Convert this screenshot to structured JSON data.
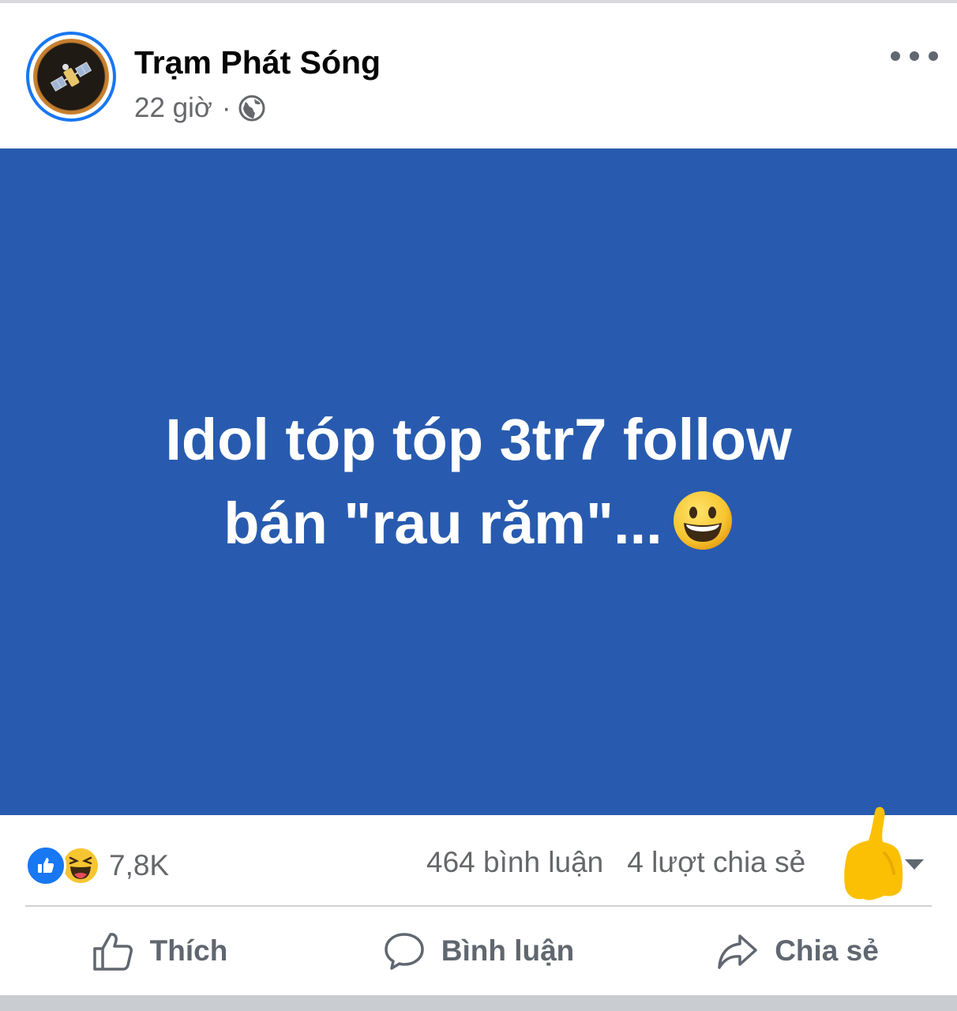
{
  "post": {
    "page_name": "Trạm Phát Sóng",
    "time": "22 giờ",
    "separator": "·",
    "audience_icon": "globe-icon",
    "menu_icon": "more-icon"
  },
  "content": {
    "line1": "Idol tóp tóp 3tr7 follow",
    "line2": "bán \"rau răm\"...",
    "emoji": "grinning-face",
    "background_color": "#285baf"
  },
  "stats": {
    "reaction_icons": [
      "like-icon",
      "haha-icon"
    ],
    "reaction_count": "7,8K",
    "comments": "464 bình luận",
    "shares": "4 lượt chia sẻ"
  },
  "actions": {
    "like": "Thích",
    "comment": "Bình luận",
    "share": "Chia sẻ"
  },
  "colors": {
    "accent": "#1877f2",
    "secondary_text": "#65676b",
    "scribble": "#fbc004"
  }
}
